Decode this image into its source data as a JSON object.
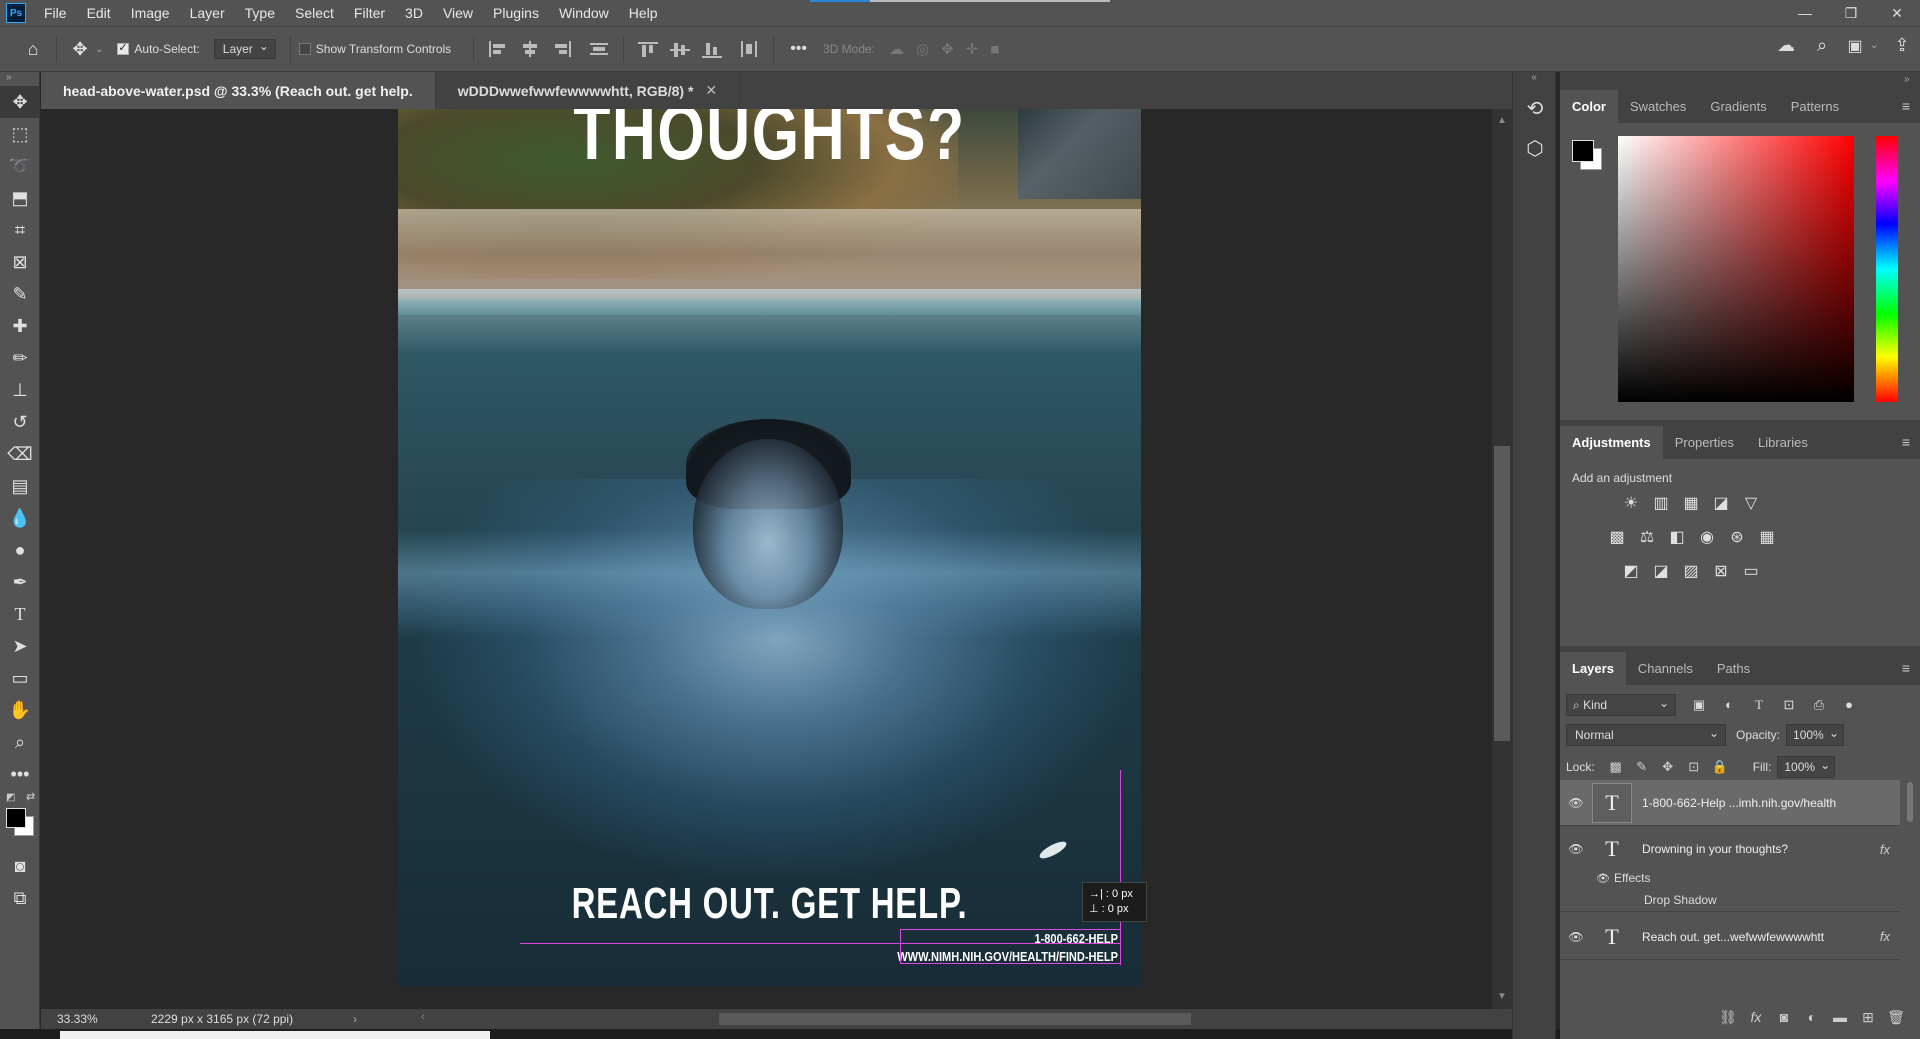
{
  "app": {
    "logo": "Ps",
    "menus": [
      "File",
      "Edit",
      "Image",
      "Layer",
      "Type",
      "Select",
      "Filter",
      "3D",
      "View",
      "Plugins",
      "Window",
      "Help"
    ]
  },
  "options_bar": {
    "auto_select_label": "Auto-Select:",
    "auto_select_checked": true,
    "layer_dropdown": "Layer",
    "show_transform_label": "Show Transform Controls",
    "show_transform_checked": false,
    "more_label": "•••",
    "mode_label": "3D Mode:"
  },
  "tabs": [
    {
      "label": "head-above-water.psd @ 33.3% (Reach out. get help.",
      "active": true
    },
    {
      "label": "wDDDwwefwwfewwwwhtt, RGB/8) *",
      "active": false
    }
  ],
  "poster": {
    "headline_top": "THOUGHTS?",
    "headline": "REACH OUT. GET HELP.",
    "phone": "1-800-662-HELP",
    "url": "WWW.NIMH.NIH.GOV/HEALTH/FIND-HELP"
  },
  "measure": {
    "dx": "→| : 0 px",
    "dy": "⊥ : 0 px"
  },
  "status": {
    "zoom": "33.33%",
    "doc_info": "2229 px x 3165 px (72 ppi)"
  },
  "panels": {
    "color_tabs": [
      "Color",
      "Swatches",
      "Gradients",
      "Patterns"
    ],
    "adjust_tabs": [
      "Adjustments",
      "Properties",
      "Libraries"
    ],
    "adjust_caption": "Add an adjustment",
    "layers_tabs": [
      "Layers",
      "Channels",
      "Paths"
    ],
    "kind_label": "Kind",
    "blend_mode": "Normal",
    "opacity_label": "Opacity:",
    "opacity_value": "100%",
    "lock_label": "Lock:",
    "fill_label": "Fill:",
    "fill_value": "100%"
  },
  "layers": [
    {
      "name": "1-800-662-Help      ...imh.nih.gov/health",
      "selected": true,
      "fx": ""
    },
    {
      "name": "Drowning in your  thoughts?",
      "selected": false,
      "fx": "fx"
    },
    {
      "name": "Reach out. get...wefwwfewwwwhtt",
      "selected": false,
      "fx": "fx"
    }
  ],
  "layer_effects": {
    "effects_label": "Effects",
    "drop_shadow_label": "Drop Shadow"
  },
  "colors": {
    "accent": "#2a85d6",
    "guide": "#e046e6"
  }
}
